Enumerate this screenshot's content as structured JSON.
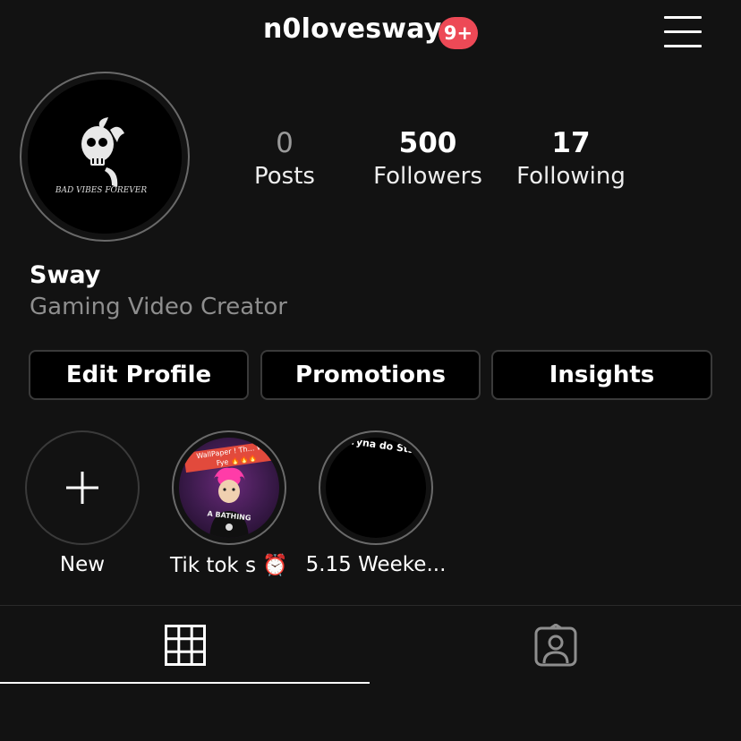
{
  "header": {
    "username": "n0lovesway",
    "notification_badge": "9+",
    "badge_color": "#ed4956",
    "menu_icon": "hamburger-menu-icon"
  },
  "profile": {
    "avatar_caption": "BAD VIBES FOREVER",
    "name": "Sway",
    "bio": "Gaming Video Creator"
  },
  "stats": [
    {
      "value": "0",
      "label": "Posts"
    },
    {
      "value": "500",
      "label": "Followers"
    },
    {
      "value": "17",
      "label": "Following"
    }
  ],
  "buttons": {
    "edit_profile": "Edit Profile",
    "promotions": "Promotions",
    "insights": "Insights"
  },
  "highlights": [
    {
      "label": "New",
      "icon": "plus-icon"
    },
    {
      "label": "Tik tok s ⏰",
      "thumb_top_text": "WallPaper ! Th... Were Fye 🔥🔥🔥",
      "thumb_bottom_text": "A BATHING"
    },
    {
      "label": "5.15 Weeke...",
      "thumb_top_text": "tryna do Sts"
    }
  ],
  "tabs": {
    "grid_icon": "grid-icon",
    "tagged_icon": "tagged-person-icon",
    "active": "grid"
  }
}
